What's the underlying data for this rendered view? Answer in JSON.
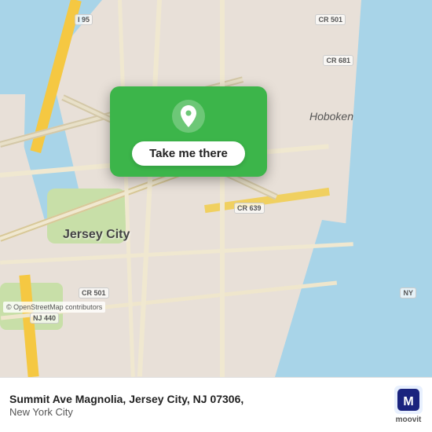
{
  "map": {
    "background_color": "#e8e0d8",
    "water_color": "#a8d4e8",
    "park_color": "#c8dfa8"
  },
  "labels": {
    "jersey_city": "Jersey City",
    "hoboken": "Hoboken",
    "cr501_top": "CR 501",
    "cr681": "CR 681",
    "cr639": "CR 639",
    "cr501_bottom": "CR 501",
    "i95": "I 95",
    "nj440": "NJ 440",
    "ny": "NY"
  },
  "popup": {
    "button_label": "Take me there"
  },
  "attribution": {
    "text": "© OpenStreetMap contributors"
  },
  "bottom_bar": {
    "address_line1": "Summit Ave Magnolia, Jersey City, NJ 07306,",
    "address_line2": "New York City",
    "moovit_label": "moovit"
  }
}
